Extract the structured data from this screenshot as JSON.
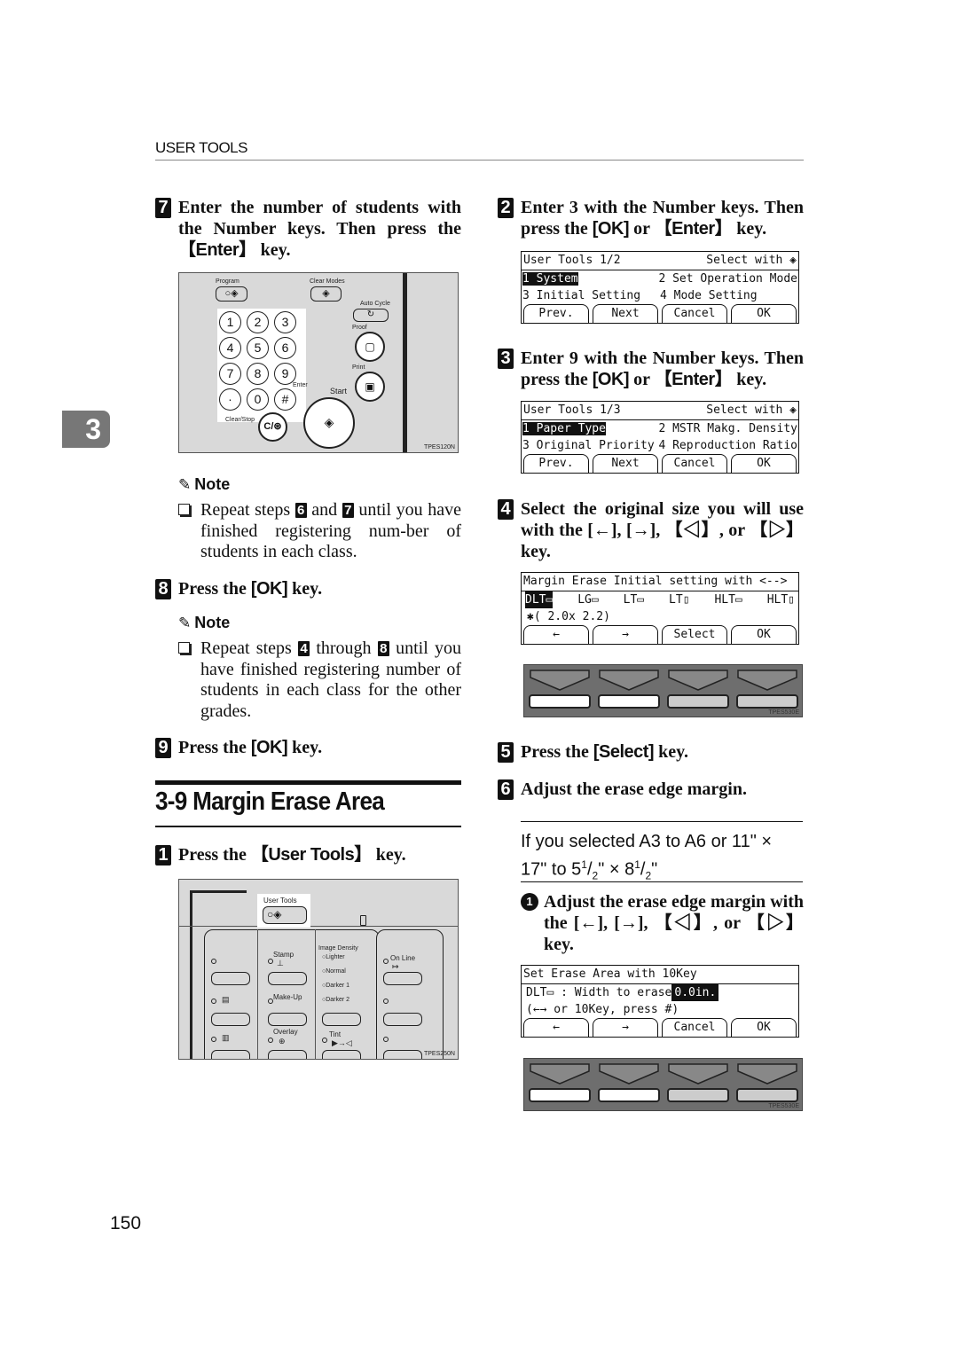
{
  "header": {
    "running_head": "USER TOOLS"
  },
  "chapter_tab": "3",
  "page_number": "150",
  "left": {
    "step7": {
      "num": "7",
      "text_a": "Enter the number of students with the Number keys. Then press the ",
      "key": "【Enter】",
      "text_b": " key."
    },
    "panel1": {
      "labels": {
        "program": "Program",
        "clear_modes": "Clear Modes",
        "auto_cycle": "Auto Cycle",
        "proof": "Proof",
        "print": "Print",
        "enter": "Enter",
        "start": "Start",
        "clear_stop": "Clear/Stop",
        "clear_stop_key": "C/⊛",
        "code": "TPES120N"
      },
      "keys": [
        "1",
        "2",
        "3",
        "4",
        "5",
        "6",
        "7",
        "8",
        "9",
        "·",
        "0",
        "#"
      ]
    },
    "note1": {
      "title": "Note",
      "text_a": "Repeat steps ",
      "n1": "6",
      "text_b": " and ",
      "n2": "7",
      "text_c": " until you have finished registering num-ber of students in each class."
    },
    "step8": {
      "num": "8",
      "text_a": "Press the ",
      "key": "[OK]",
      "text_b": " key."
    },
    "note2": {
      "title": "Note",
      "text_a": "Repeat steps ",
      "n1": "4",
      "text_b": " through ",
      "n2": "8",
      "text_c": " until you have finished registering number of students in each class for the other grades."
    },
    "step9": {
      "num": "9",
      "text_a": "Press the ",
      "key": "[OK]",
      "text_b": " key."
    },
    "section_title": "3-9 Margin Erase Area",
    "step1": {
      "num": "1",
      "text_a": "Press the ",
      "key": "【User Tools】",
      "text_b": " key."
    },
    "panel2": {
      "labels": {
        "user_tools": "User Tools",
        "stamp": "Stamp",
        "make_up": "Make-Up",
        "overlay": "Overlay",
        "image_density": "Image Density",
        "lighter": "Lighter",
        "normal": "Normal",
        "darker1": "Darker 1",
        "darker2": "Darker 2",
        "tint": "Tint",
        "on_line": "On Line",
        "code": "TPES250N"
      }
    }
  },
  "right": {
    "step2": {
      "num": "2",
      "text_a": "Enter 3 with the Number keys. Then press the ",
      "key1": "[OK]",
      "mid": " or ",
      "key2": "【Enter】",
      "text_b": " key."
    },
    "lcd1": {
      "title": "User Tools 1/2",
      "hint": "Select with ◈",
      "row1a": "1 System",
      "row1b": "2 Set Operation Mode",
      "row2a": "3 Initial Setting",
      "row2b": "4 Mode Setting",
      "buttons": [
        "Prev.",
        "Next",
        "Cancel",
        "OK"
      ]
    },
    "step3": {
      "num": "3",
      "text_a": "Enter 9 with the Number keys. Then press the ",
      "key1": "[OK]",
      "mid": " or ",
      "key2": "【Enter】",
      "text_b": " key."
    },
    "lcd2": {
      "title": "User Tools 1/3",
      "hint": "Select with ◈",
      "row1a": "1 Paper Type",
      "row1b": "2 MSTR Makg. Density",
      "row2a": "3 Original Priority",
      "row2b": "4 Reproduction Ratio",
      "buttons": [
        "Prev.",
        "Next",
        "Cancel",
        "OK"
      ]
    },
    "step4": {
      "num": "4",
      "text_a": "Select the original size you will use with the [←], [→], 【◁】, or 【▷】 key."
    },
    "lcd3": {
      "title": "Margin Erase Initial setting with <-->",
      "sizes": [
        "DLT▭",
        "LG▭",
        "LT▭",
        "LT▯",
        "HLT▭",
        "HLT▯"
      ],
      "value": "✱( 2.0x 2.2)",
      "buttons": [
        "←",
        "→",
        "Select",
        "OK"
      ]
    },
    "keystrip1_code": "TPES530E",
    "step5": {
      "num": "5",
      "text_a": "Press the ",
      "key": "[Select]",
      "text_b": " key."
    },
    "step6": {
      "num": "6",
      "text_a": "Adjust the erase edge margin."
    },
    "condition": {
      "line1": "If you selected A3 to A6 or 11\" × ",
      "line2a": "17\" to 5",
      "sup": "1",
      "slash": "/",
      "sub": "2",
      "line2b": "\" × 8",
      "line2c": "\""
    },
    "substep1": {
      "num": "1",
      "text": "Adjust the erase edge margin with the [←], [→], 【◁】, or 【▷】 key."
    },
    "lcd4": {
      "title": "Set Erase Area with 10Key",
      "row1a": "DLT▭ : Width to erase ",
      "row1b": "0.0in.",
      "row2": " (←→ or 10Key, press #)",
      "buttons": [
        "←",
        "→",
        "Cancel",
        "OK"
      ]
    },
    "keystrip2_code": "TPES530E"
  }
}
